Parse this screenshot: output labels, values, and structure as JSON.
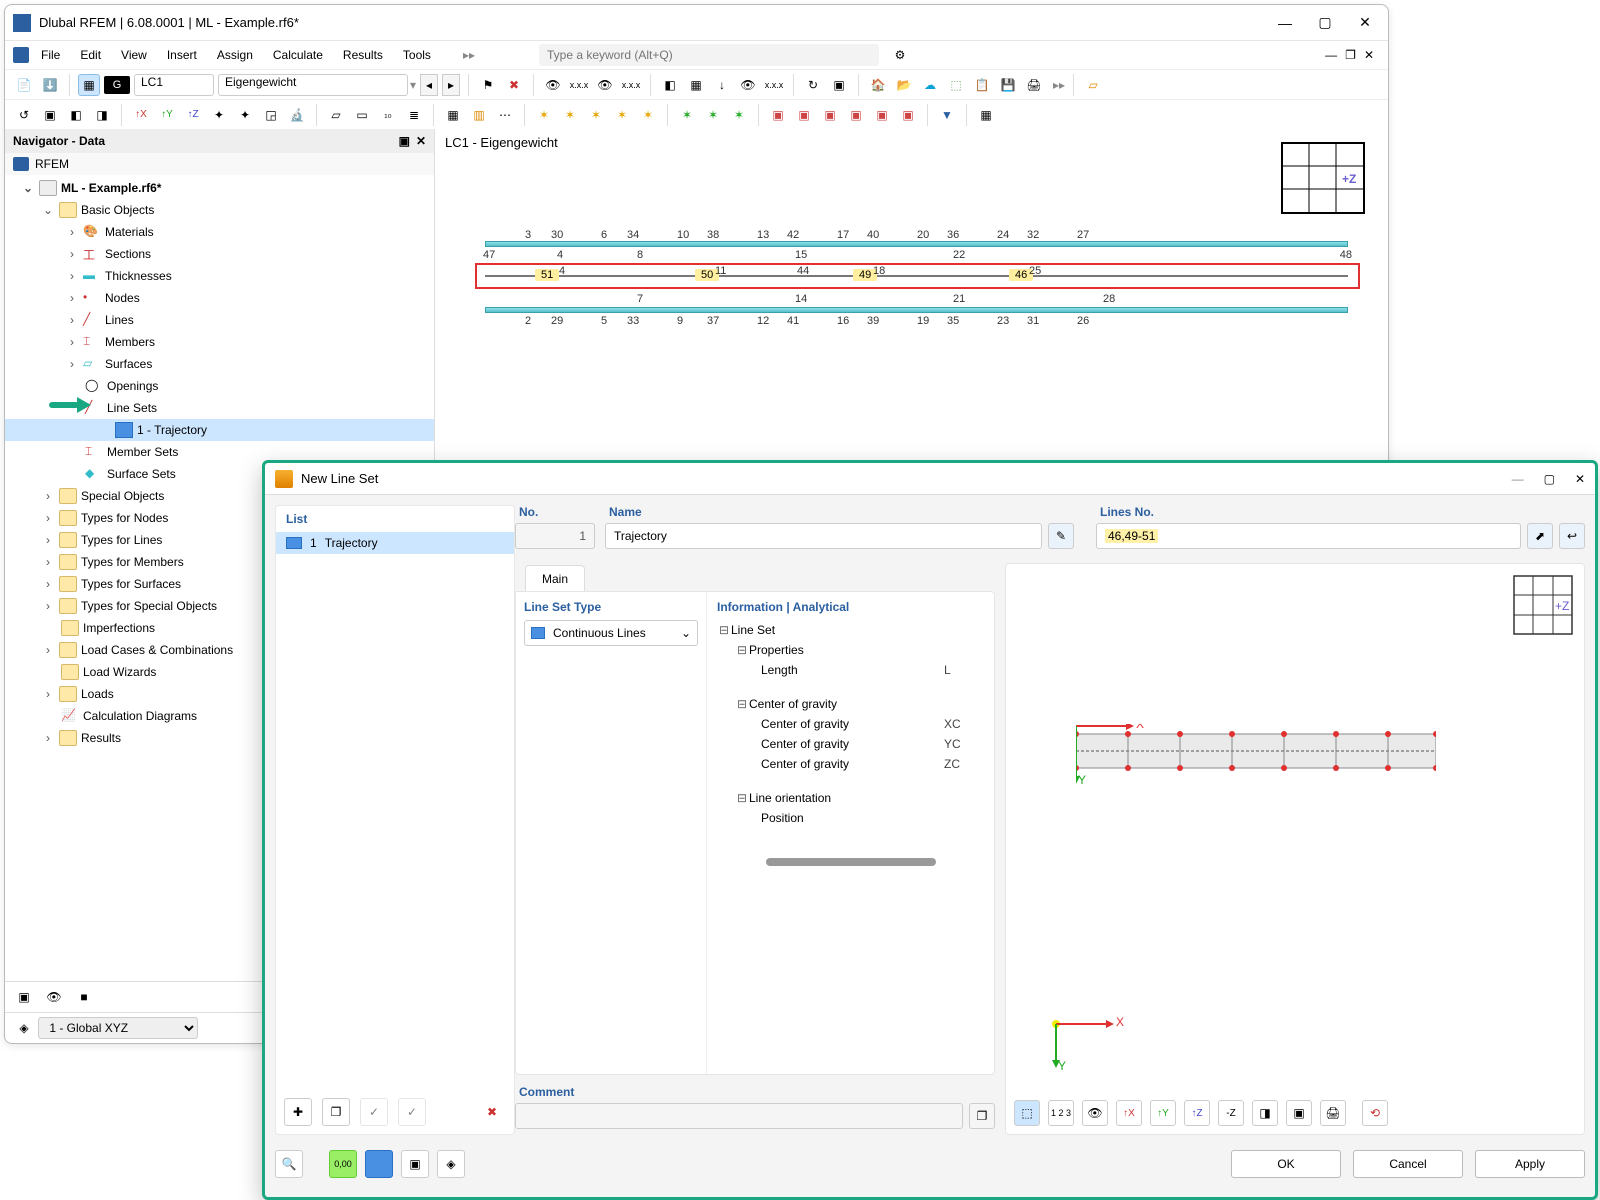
{
  "app": {
    "title": "Dlubal RFEM | 6.08.0001 | ML - Example.rf6*",
    "search_placeholder": "Type a keyword (Alt+Q)",
    "lc_badge": "G",
    "lc_id": "LC1",
    "lc_name": "Eigengewicht",
    "work_header": "LC1 - Eigengewicht",
    "axes_label": "+Z",
    "coord_system": "1 - Global XYZ"
  },
  "menu": [
    "File",
    "Edit",
    "View",
    "Insert",
    "Assign",
    "Calculate",
    "Results",
    "Tools"
  ],
  "navigator": {
    "title": "Navigator - Data",
    "root_app": "RFEM",
    "model": "ML - Example.rf6*",
    "basic_objects": "Basic Objects",
    "items_a": [
      "Materials",
      "Sections",
      "Thicknesses",
      "Nodes",
      "Lines",
      "Members",
      "Surfaces",
      "Openings",
      "Line Sets"
    ],
    "trajectory": "1 - Trajectory",
    "items_b": [
      "Member Sets",
      "Surface Sets"
    ],
    "folders": [
      "Special Objects",
      "Types for Nodes",
      "Types for Lines",
      "Types for Members",
      "Types for Surfaces",
      "Types for Special Objects",
      "Imperfections",
      "Load Cases & Combinations",
      "Load Wizards",
      "Loads",
      "Calculation Diagrams",
      "Results"
    ]
  },
  "diagram": {
    "top_row": {
      "left_end": "47",
      "right_end": "48",
      "pairs": [
        [
          "3",
          "30"
        ],
        [
          "6",
          "34"
        ],
        [
          "10",
          "38"
        ],
        [
          "13",
          "42"
        ],
        [
          "17",
          "40"
        ],
        [
          "20",
          "36"
        ],
        [
          "24",
          "32"
        ],
        [
          "27",
          ""
        ]
      ],
      "mids": [
        "4",
        "8",
        "15",
        "22"
      ]
    },
    "mid_row": {
      "labels": [
        "51",
        "50",
        "49",
        "46"
      ],
      "top_nums": [
        "4",
        "11",
        "44",
        "18",
        "25"
      ]
    },
    "bot_row": {
      "pairs": [
        [
          "2",
          "29"
        ],
        [
          "5",
          "33"
        ],
        [
          "9",
          "37"
        ],
        [
          "12",
          "41"
        ],
        [
          "16",
          "39"
        ],
        [
          "19",
          "35"
        ],
        [
          "23",
          "31"
        ],
        [
          "26",
          ""
        ]
      ],
      "mids": [
        "7",
        "14",
        "21",
        "28"
      ]
    }
  },
  "dialog": {
    "title": "New Line Set",
    "list_header": "List",
    "list_row_no": "1",
    "list_row_name": "Trajectory",
    "no_label": "No.",
    "no_value": "1",
    "name_label": "Name",
    "name_value": "Trajectory",
    "lines_label": "Lines No.",
    "lines_value": "46,49-51",
    "tab_main": "Main",
    "type_header": "Line Set Type",
    "type_value": "Continuous Lines",
    "info_header": "Information | Analytical",
    "info": {
      "lineset": "Line Set",
      "properties": "Properties",
      "length": "Length",
      "length_val": "L",
      "cog": "Center of gravity",
      "cogx": "Center of gravity",
      "cogx_val": "XC",
      "cogy": "Center of gravity",
      "cogy_val": "YC",
      "cogz": "Center of gravity",
      "cogz_val": "ZC",
      "orient": "Line orientation",
      "position": "Position"
    },
    "comment_label": "Comment",
    "preview_axes": {
      "x": "X",
      "y": "Y",
      "z": "+Z"
    },
    "buttons": {
      "ok": "OK",
      "cancel": "Cancel",
      "apply": "Apply"
    }
  }
}
